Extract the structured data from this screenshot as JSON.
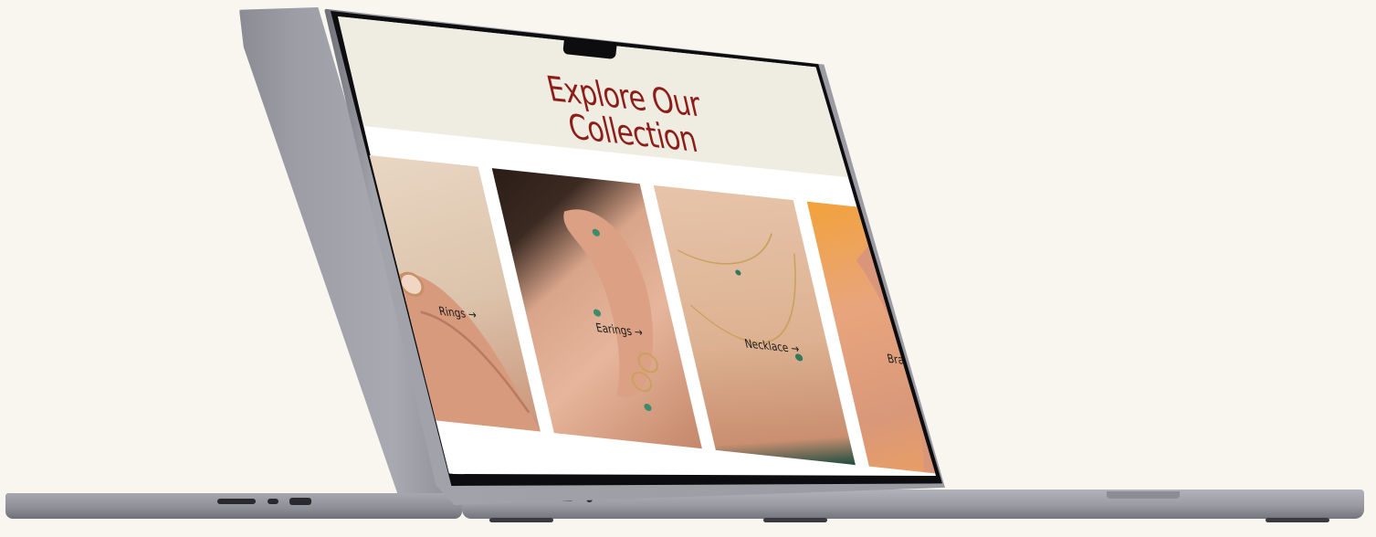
{
  "page": {
    "title": "Explore Our Collection",
    "title_line_1": "Explore Our",
    "title_line_2": "Collection",
    "accent_color": "#8c1d18",
    "header_background": "#efede2",
    "page_background": "#f8f6ef"
  },
  "collections": [
    {
      "label": "Rings",
      "arrow": "→",
      "image": "ring-on-hand-photo"
    },
    {
      "label": "Earings",
      "arrow": "→",
      "image": "earrings-on-ear-photo"
    },
    {
      "label": "Necklace",
      "arrow": "→",
      "image": "necklace-on-neck-photo"
    },
    {
      "label": "Bracelet",
      "arrow": "→",
      "image": "bracelet-on-wrist-photo"
    }
  ]
}
